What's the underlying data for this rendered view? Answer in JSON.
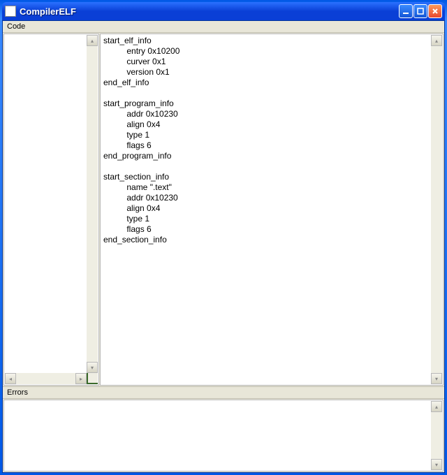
{
  "window": {
    "title": "CompilerELF"
  },
  "labels": {
    "code": "Code",
    "errors": "Errors"
  },
  "code_text": "start_elf_info\n          entry 0x10200\n          curver 0x1\n          version 0x1\nend_elf_info\n\nstart_program_info\n          addr 0x10230\n          align 0x4\n          type 1\n          flags 6\nend_program_info\n\nstart_section_info\n          name \".text\"\n          addr 0x10230\n          align 0x4\n          type 1\n          flags 6\nend_section_info",
  "errors_text": ""
}
